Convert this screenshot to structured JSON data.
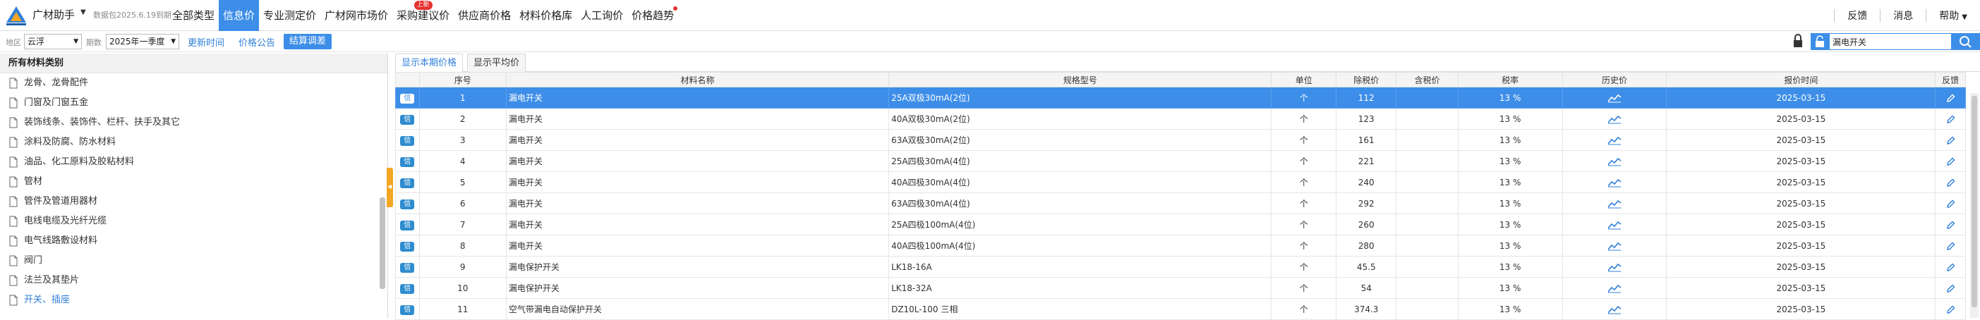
{
  "app": {
    "name": "广材助手",
    "expiry": "数据包2025.6.19到期"
  },
  "nav": [
    {
      "label": "全部类型"
    },
    {
      "label": "信息价",
      "active": true
    },
    {
      "label": "专业测定价"
    },
    {
      "label": "广材网市场价"
    },
    {
      "label": "采购建议价",
      "badge": "上新"
    },
    {
      "label": "供应商价格"
    },
    {
      "label": "材料价格库"
    },
    {
      "label": "人工询价"
    },
    {
      "label": "价格趋势",
      "dot": true
    }
  ],
  "topright": {
    "feedback": "反馈",
    "messages": "消息",
    "help": "帮助"
  },
  "filter": {
    "region_label": "地区",
    "region_value": "云浮",
    "period_label": "期数",
    "period_value": "2025年一季度",
    "update_time": "更新时间",
    "price_notice": "价格公告",
    "settle_adjust": "结算调差"
  },
  "search": {
    "value": "漏电开关"
  },
  "sidebar": {
    "title": "所有材料类别",
    "items": [
      "龙骨、龙骨配件",
      "门窗及门窗五金",
      "装饰线条、装饰件、栏杆、扶手及其它",
      "涂料及防腐、防水材料",
      "油品、化工原料及胶粘材料",
      "管材",
      "管件及管道用器材",
      "电线电缆及光纤光缆",
      "电气线路敷设材料",
      "阀门",
      "法兰及其垫片",
      "开关、插座"
    ]
  },
  "tabs": {
    "current": "显示本期价格",
    "average": "显示平均价"
  },
  "table": {
    "headers": {
      "index": "序号",
      "name": "材料名称",
      "spec": "规格型号",
      "unit": "单位",
      "price_ex": "除税价",
      "price_in": "含税价",
      "tax": "税率",
      "history": "历史价",
      "date": "报价时间",
      "feedback": "反馈"
    },
    "info_badge": "信",
    "rows": [
      {
        "idx": "1",
        "name": "漏电开关",
        "spec": "25A双极30mA(2位)",
        "unit": "个",
        "price_ex": "112",
        "price_in": "",
        "tax": "13 %",
        "date": "2025-03-15"
      },
      {
        "idx": "2",
        "name": "漏电开关",
        "spec": "40A双极30mA(2位)",
        "unit": "个",
        "price_ex": "123",
        "price_in": "",
        "tax": "13 %",
        "date": "2025-03-15"
      },
      {
        "idx": "3",
        "name": "漏电开关",
        "spec": "63A双极30mA(2位)",
        "unit": "个",
        "price_ex": "161",
        "price_in": "",
        "tax": "13 %",
        "date": "2025-03-15"
      },
      {
        "idx": "4",
        "name": "漏电开关",
        "spec": "25A四极30mA(4位)",
        "unit": "个",
        "price_ex": "221",
        "price_in": "",
        "tax": "13 %",
        "date": "2025-03-15"
      },
      {
        "idx": "5",
        "name": "漏电开关",
        "spec": "40A四极30mA(4位)",
        "unit": "个",
        "price_ex": "240",
        "price_in": "",
        "tax": "13 %",
        "date": "2025-03-15"
      },
      {
        "idx": "6",
        "name": "漏电开关",
        "spec": "63A四极30mA(4位)",
        "unit": "个",
        "price_ex": "292",
        "price_in": "",
        "tax": "13 %",
        "date": "2025-03-15"
      },
      {
        "idx": "7",
        "name": "漏电开关",
        "spec": "25A四极100mA(4位)",
        "unit": "个",
        "price_ex": "260",
        "price_in": "",
        "tax": "13 %",
        "date": "2025-03-15"
      },
      {
        "idx": "8",
        "name": "漏电开关",
        "spec": "40A四极100mA(4位)",
        "unit": "个",
        "price_ex": "280",
        "price_in": "",
        "tax": "13 %",
        "date": "2025-03-15"
      },
      {
        "idx": "9",
        "name": "漏电保护开关",
        "spec": "LK18-16A",
        "unit": "个",
        "price_ex": "45.5",
        "price_in": "",
        "tax": "13 %",
        "date": "2025-03-15"
      },
      {
        "idx": "10",
        "name": "漏电保护开关",
        "spec": "LK18-32A",
        "unit": "个",
        "price_ex": "54",
        "price_in": "",
        "tax": "13 %",
        "date": "2025-03-15"
      },
      {
        "idx": "11",
        "name": "空气带漏电自动保护开关",
        "spec": "DZ10L-100 三相",
        "unit": "个",
        "price_ex": "374.3",
        "price_in": "",
        "tax": "13 %",
        "date": "2025-03-15"
      }
    ]
  },
  "colors": {
    "accent": "#3d8ee8",
    "link": "#2f7fd8",
    "badge": "#e5312f",
    "collapse": "#f5a623"
  }
}
